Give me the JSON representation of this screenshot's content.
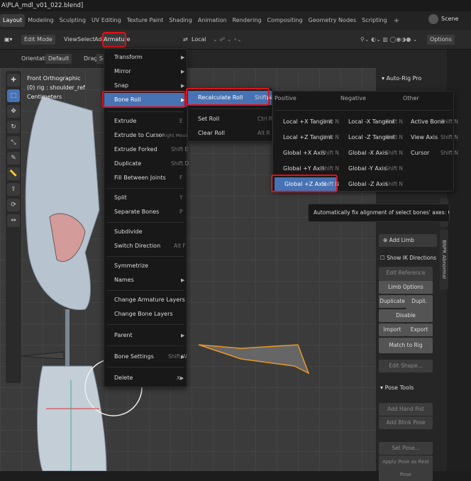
{
  "window": {
    "title": "A\\PLA_mdl_v01_022.blend]"
  },
  "workspaces": [
    "Layout",
    "Modeling",
    "Sculpting",
    "UV Editing",
    "Texture Paint",
    "Shading",
    "Animation",
    "Rendering",
    "Compositing",
    "Geometry Nodes",
    "Scripting"
  ],
  "add_workspace": "+",
  "scene": "Scene",
  "header": {
    "mode": "Edit Mode",
    "view": "View",
    "select": "Select",
    "add": "Add",
    "armature": "Armature",
    "pivot": "Local",
    "options": "Options"
  },
  "subheader": {
    "orientation_label": "Orientation:",
    "orientation_value": "Default",
    "drag_label": "Drag:",
    "drag_value": "Sel"
  },
  "viewport": {
    "view_name": "Front Orthographic",
    "object": "(0) rig : shoulder_ref",
    "units": "Centimeters"
  },
  "armature_menu": [
    {
      "label": "Transform",
      "arrow": "▶"
    },
    {
      "label": "Mirror",
      "arrow": "▶"
    },
    {
      "label": "Snap",
      "arrow": "▶"
    },
    {
      "label": "Bone Roll",
      "arrow": "▶"
    },
    {
      "label": "Extrude",
      "shortcut": "E"
    },
    {
      "label": "Extrude to Cursor",
      "shortcut": "Ctrl Right Mouse"
    },
    {
      "label": "Extrude Forked",
      "shortcut": "Shift E"
    },
    {
      "label": "Duplicate",
      "shortcut": "Shift D"
    },
    {
      "label": "Fill Between Joints",
      "shortcut": "F"
    },
    {
      "label": "Split",
      "shortcut": "Y"
    },
    {
      "label": "Separate Bones",
      "shortcut": "P"
    },
    {
      "label": "Subdivide"
    },
    {
      "label": "Switch Direction",
      "shortcut": "Alt F"
    },
    {
      "label": "Symmetrize"
    },
    {
      "label": "Names",
      "arrow": "▶"
    },
    {
      "label": "Change Armature Layers"
    },
    {
      "label": "Change Bone Layers"
    },
    {
      "label": "Parent",
      "arrow": "▶"
    },
    {
      "label": "Bone Settings",
      "shortcut": "Shift W",
      "arrow": "▶"
    },
    {
      "label": "Delete",
      "arrow": "X▶"
    }
  ],
  "bone_roll_menu": [
    {
      "label": "Recalculate Roll",
      "shortcut": "Shift N",
      "arrow": "▶"
    },
    {
      "label": "Set Roll",
      "shortcut": "Ctrl R"
    },
    {
      "label": "Clear Roll",
      "shortcut": "Alt R"
    }
  ],
  "recalc_menu": {
    "headers": [
      "Positive",
      "Negative",
      "Other"
    ],
    "positive": [
      {
        "label": "Local +X Tangent",
        "shortcut": "Shift N"
      },
      {
        "label": "Local +Z Tangent",
        "shortcut": "Shift N"
      },
      {
        "label": "Global +X Axis",
        "shortcut": "Shift N"
      },
      {
        "label": "Global +Y Axis",
        "shortcut": "Shift N"
      },
      {
        "label": "Global +Z Axis",
        "shortcut": "Shift N"
      }
    ],
    "negative": [
      {
        "label": "Local -X Tangent",
        "shortcut": "Shift N"
      },
      {
        "label": "Local -Z Tangent",
        "shortcut": "Shift N"
      },
      {
        "label": "Global -X Axis",
        "shortcut": "Shift N"
      },
      {
        "label": "Global -Y Axis",
        "shortcut": "Shift N"
      },
      {
        "label": "Global -Z Axis",
        "shortcut": "Shift N"
      }
    ],
    "other": [
      {
        "label": "Active Bone",
        "shortcut": "Shift N"
      },
      {
        "label": "View Axis",
        "shortcut": "Shift N"
      },
      {
        "label": "Cursor",
        "shortcut": "Shift N"
      }
    ]
  },
  "tooltip": "Automatically fix alignment of select bones' axes:  Global +Z Axis",
  "auto_rig": {
    "title": "Auto-Rig Pro",
    "add_limb": "Add Limb",
    "show_ik": "Show IK Directions",
    "edit_ref": "Edit Reference Bones",
    "limb_options": "Limb Options",
    "duplicate": "Duplicate",
    "dupli_mirror": "Dupli. Mirror",
    "disable": "Disable",
    "import": "Import",
    "export": "Export",
    "match_to_rig": "Match to Rig",
    "edit_shape": "Edit Shape...",
    "pose_tools": "Pose Tools",
    "add_hand_fist": "Add Hand Fist",
    "add_blink_pose": "Add Blink Pose",
    "set_pose": "Set Pose...",
    "apply_rest": "Apply Pose as Rest Pose"
  },
  "side_tabs": [
    "ARP",
    "BNPR Abnormal"
  ]
}
